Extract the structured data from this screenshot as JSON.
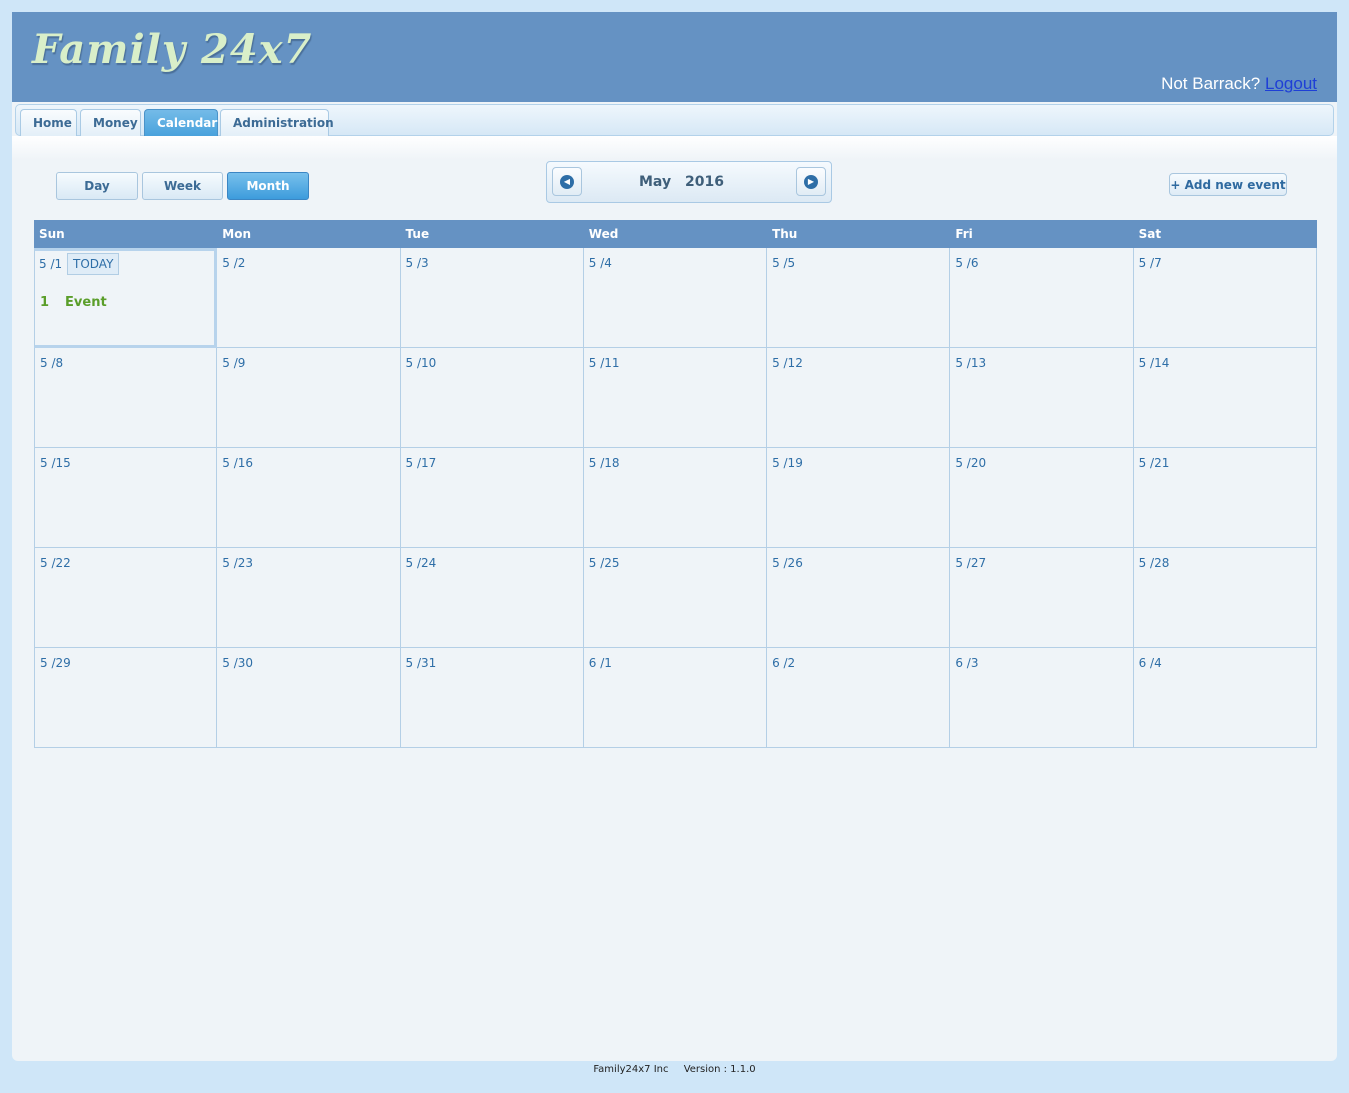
{
  "app": {
    "logo": "Family 24x7",
    "user_prompt": "Not Barrack?",
    "logout_label": "Logout"
  },
  "nav": {
    "tabs": [
      {
        "label": "Home",
        "active": false
      },
      {
        "label": "Money",
        "active": false
      },
      {
        "label": "Calendar",
        "active": true
      },
      {
        "label": "Administration",
        "active": false
      }
    ]
  },
  "calendar": {
    "views": [
      {
        "label": "Day",
        "active": false
      },
      {
        "label": "Week",
        "active": false
      },
      {
        "label": "Month",
        "active": true
      }
    ],
    "month": "May",
    "year": "2016",
    "add_event_label": "+ Add new event",
    "weekdays": [
      "Sun",
      "Mon",
      "Tue",
      "Wed",
      "Thu",
      "Fri",
      "Sat"
    ],
    "today_label": "TODAY",
    "weeks": [
      [
        "5 /1",
        "5 /2",
        "5 /3",
        "5 /4",
        "5 /5",
        "5 /6",
        "5 /7"
      ],
      [
        "5 /8",
        "5 /9",
        "5 /10",
        "5 /11",
        "5 /12",
        "5 /13",
        "5 /14"
      ],
      [
        "5 /15",
        "5 /16",
        "5 /17",
        "5 /18",
        "5 /19",
        "5 /20",
        "5 /21"
      ],
      [
        "5 /22",
        "5 /23",
        "5 /24",
        "5 /25",
        "5 /26",
        "5 /27",
        "5 /28"
      ],
      [
        "5 /29",
        "5 /30",
        "5 /31",
        "6 /1",
        "6 /2",
        "6 /3",
        "6 /4"
      ]
    ],
    "today_event": {
      "count": "1",
      "label": "Event"
    }
  },
  "footer": {
    "company": "Family24x7 Inc",
    "version": "Version : 1.1.0"
  },
  "colors": {
    "header": "#6592c3",
    "accent": "#49a2dc",
    "event": "#5a9e2a",
    "link": "#1e3fd6"
  }
}
